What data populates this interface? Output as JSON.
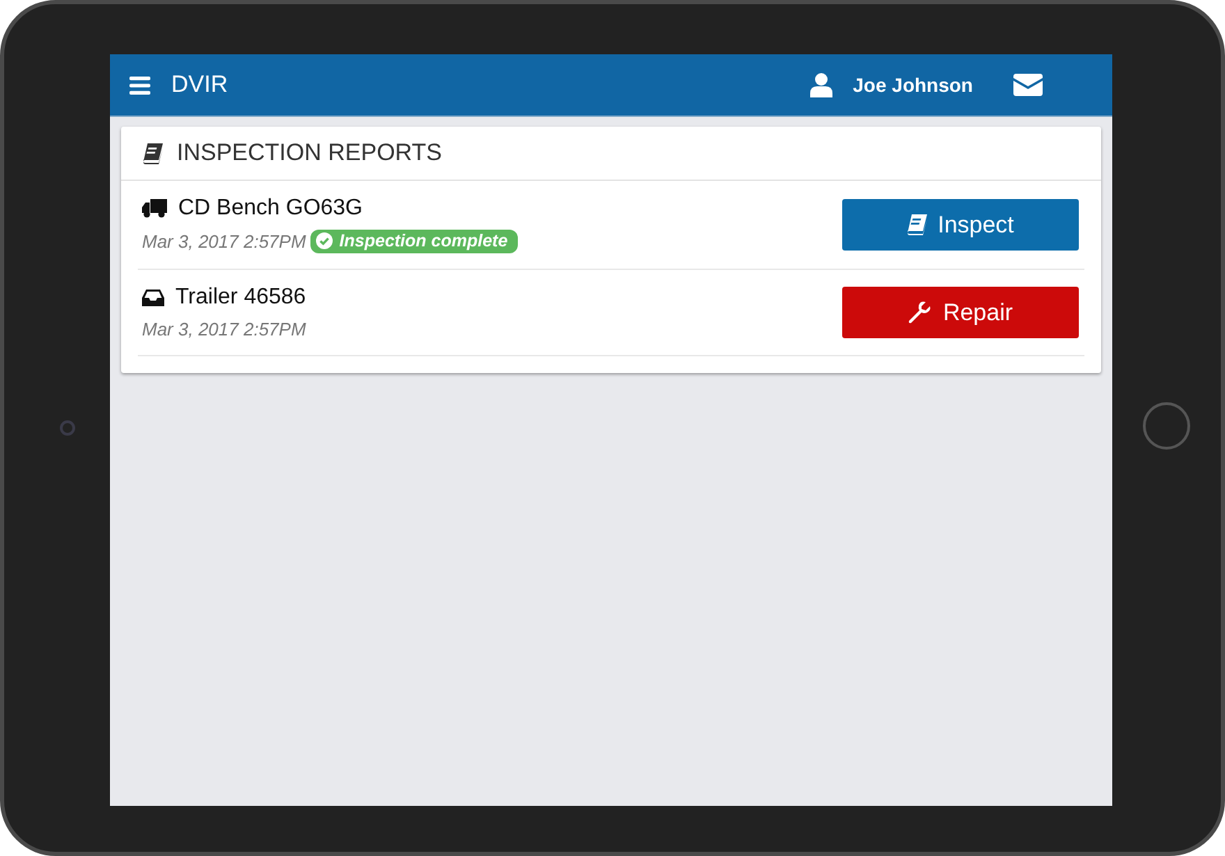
{
  "app": {
    "title": "DVIR",
    "user": "Joe Johnson"
  },
  "reports": {
    "title": "INSPECTION REPORTS",
    "items": [
      {
        "kind": "truck",
        "name": "CD Bench GO63G",
        "date": "Mar 3, 2017 2:57PM",
        "status": "Inspection complete",
        "action": {
          "kind": "inspect",
          "label": "Inspect"
        }
      },
      {
        "kind": "trailer",
        "name": "Trailer 46586",
        "date": "Mar 3, 2017 2:57PM",
        "action": {
          "kind": "repair",
          "label": "Repair"
        }
      }
    ]
  }
}
